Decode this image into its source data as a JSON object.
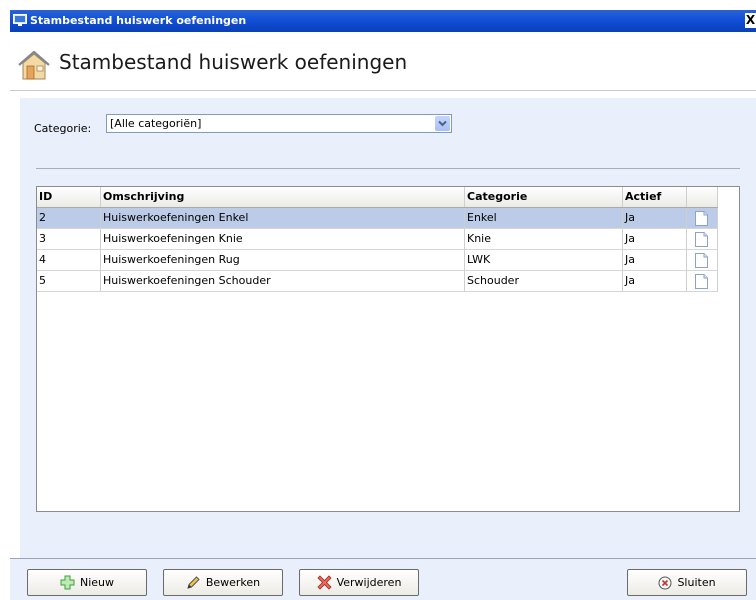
{
  "window": {
    "title": "Stambestand huiswerk oefeningen",
    "close_glyph": "X"
  },
  "header": {
    "title": "Stambestand huiswerk oefeningen",
    "icon": "home-icon"
  },
  "filter": {
    "label": "Categorie:",
    "selected": "[Alle categoriën]"
  },
  "table": {
    "columns": [
      "ID",
      "Omschrijving",
      "Categorie",
      "Actief"
    ],
    "rows": [
      {
        "id": "2",
        "description": "Huiswerkoefeningen Enkel",
        "category": "Enkel",
        "active": "Ja",
        "selected": true
      },
      {
        "id": "3",
        "description": "Huiswerkoefeningen Knie",
        "category": "Knie",
        "active": "Ja",
        "selected": false
      },
      {
        "id": "4",
        "description": "Huiswerkoefeningen Rug",
        "category": "LWK",
        "active": "Ja",
        "selected": false
      },
      {
        "id": "5",
        "description": "Huiswerkoefeningen Schouder",
        "category": "Schouder",
        "active": "Ja",
        "selected": false
      }
    ]
  },
  "buttons": {
    "new": "Nieuw",
    "edit": "Bewerken",
    "delete": "Verwijderen",
    "close": "Sluiten"
  },
  "colors": {
    "titlebar": "#0a3fb7",
    "content_bg": "#eaf0fb",
    "selected_row": "#bccce8",
    "add_icon": "#3aa23a",
    "delete_icon": "#d0302a"
  }
}
